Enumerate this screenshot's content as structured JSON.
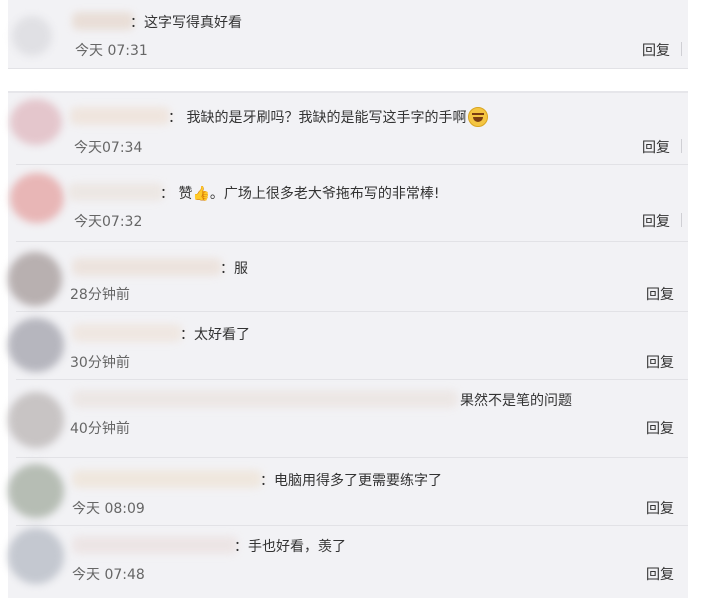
{
  "comments": [
    {
      "text": "：这字写得真好看",
      "time": "今天 07:31",
      "reply": "回复"
    },
    {
      "text": "：  我缺的是牙刷吗？我缺的是能写这手字的手啊",
      "emoji": "laughing-emoji",
      "time": "今天07:34",
      "reply": "回复"
    },
    {
      "text": "：  赞",
      "thumb": "👍",
      "text_after": "。广场上很多老大爷拖布写的非常棒!",
      "time": "今天07:32",
      "reply": "回复"
    },
    {
      "text": "：服",
      "time": "28分钟前",
      "reply": "回复"
    },
    {
      "text": "：太好看了",
      "time": "30分钟前",
      "reply": "回复"
    },
    {
      "text": "果然不是笔的问题",
      "time": "40分钟前",
      "reply": "回复"
    },
    {
      "text": "：电脑用得多了更需要练字了",
      "time": "今天 08:09",
      "reply": "回复"
    },
    {
      "text": "：手也好看，羡了",
      "time": "今天 07:48",
      "reply": "回复"
    }
  ],
  "colors": {
    "card_bg": "#f2f2f5",
    "avatar_colors": [
      "#d8d8dc",
      "#e4c6cc",
      "#e8b6b6",
      "#b8b0b0",
      "#b6b6be",
      "#c8c4c4",
      "#b6bdb4",
      "#c4c8d0"
    ]
  }
}
